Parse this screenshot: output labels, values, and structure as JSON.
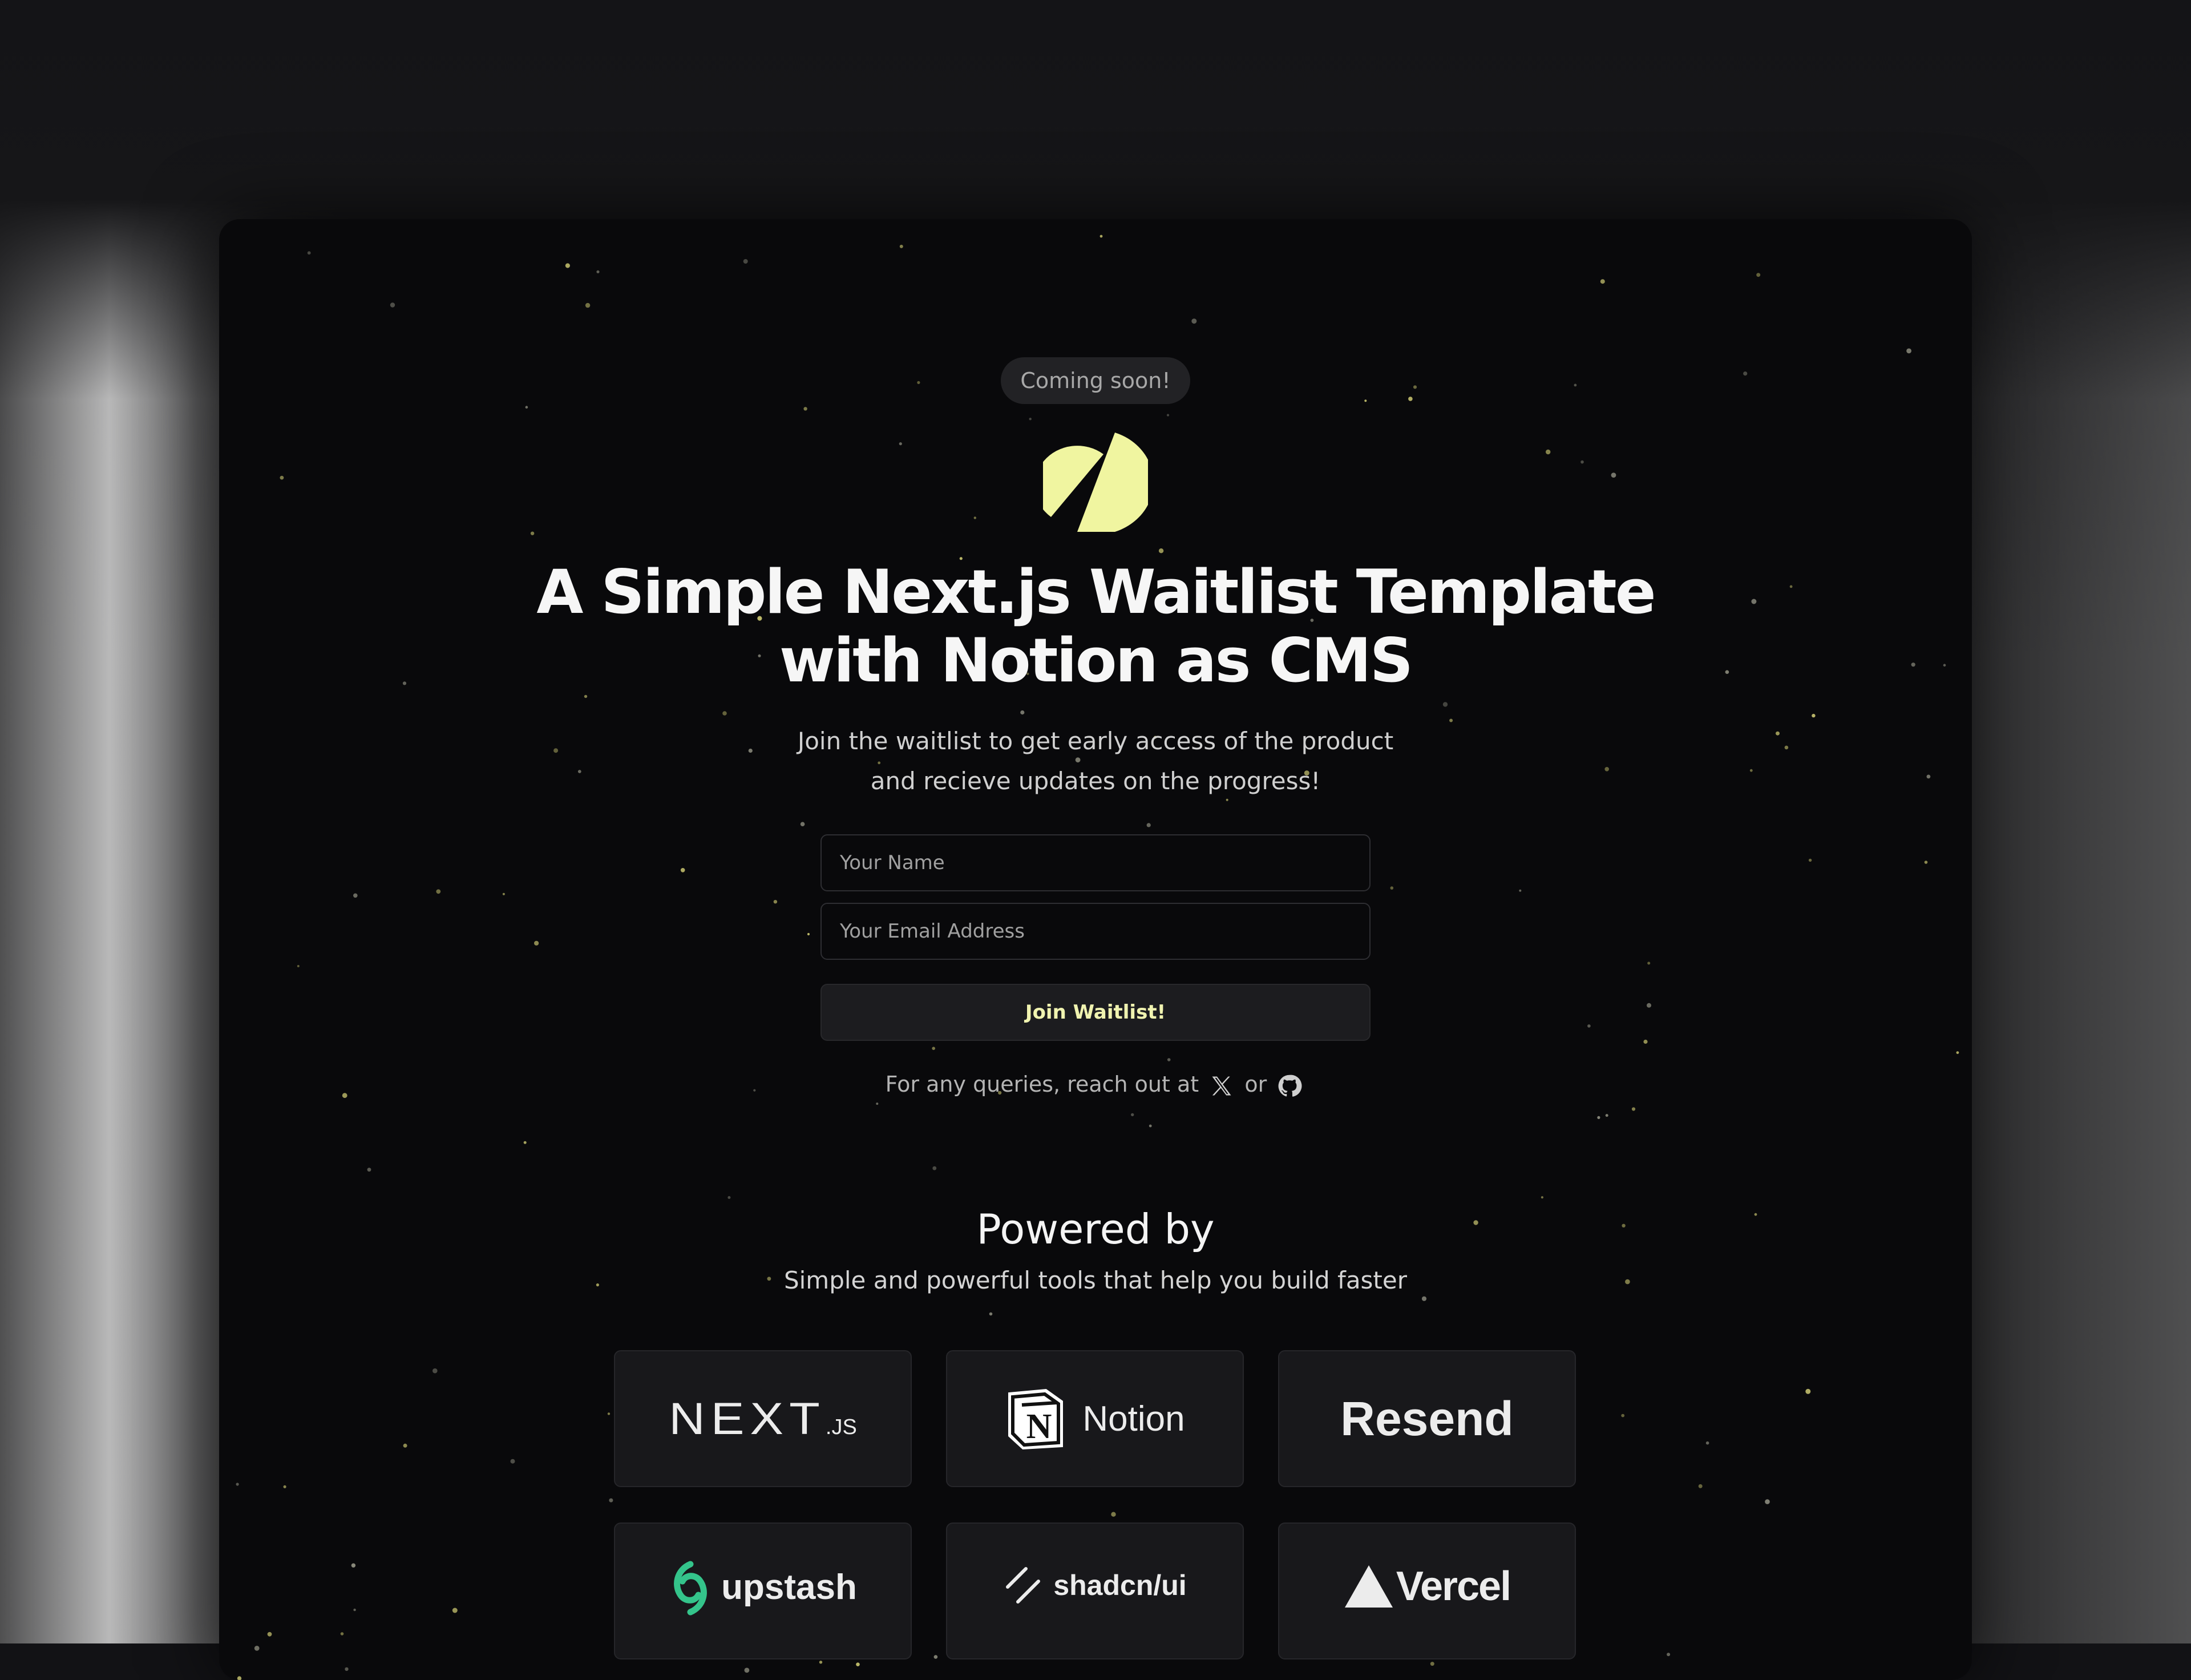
{
  "badge": {
    "label": "Coming soon!"
  },
  "hero": {
    "logo_icon": "leaf-logo-icon",
    "logo_color": "#f0f5a0",
    "headline_line1": "A Simple Next.js Waitlist Template",
    "headline_line2": "with Notion as CMS",
    "subline_line1": "Join the waitlist to get early access of the product",
    "subline_line2": "and recieve updates on the progress!"
  },
  "form": {
    "name_placeholder": "Your Name",
    "email_placeholder": "Your Email Address",
    "submit_label": "Join Waitlist!"
  },
  "contact": {
    "text": "For any queries, reach out at",
    "x_icon": "x-icon",
    "or_text": "or",
    "github_icon": "github-icon"
  },
  "powered": {
    "title": "Powered by",
    "subtitle": "Simple and powerful tools that help you build faster",
    "cards": [
      {
        "name": "NEXT.js",
        "main": "NEXT",
        "suffix": ".JS",
        "icon": ""
      },
      {
        "name": "Notion",
        "icon": "notion-icon"
      },
      {
        "name": "Resend",
        "icon": ""
      },
      {
        "name": "upstash",
        "icon": "upstash-icon",
        "icon_color": "#34c48b"
      },
      {
        "name": "shadcn/ui",
        "icon": "shadcn-icon"
      },
      {
        "name": "Vercel",
        "icon": "vercel-triangle-icon"
      }
    ]
  },
  "colors": {
    "background": "#09090b",
    "accent": "#f0f5a0",
    "card": "#18181b",
    "star": "#c8c470"
  }
}
